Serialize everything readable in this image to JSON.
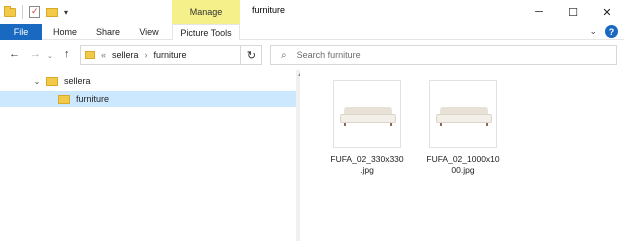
{
  "window": {
    "title": "furniture",
    "contextual_group": "Manage",
    "controls": {
      "minimize": "─",
      "maximize": "☐",
      "close": "✕"
    }
  },
  "quick_access": {
    "dropdown": "▾"
  },
  "ribbon": {
    "tabs": [
      "File",
      "Home",
      "Share",
      "View",
      "Picture Tools"
    ],
    "collapse": "⌄",
    "help": "?"
  },
  "address": {
    "back": "←",
    "forward": "→",
    "history": "⌄",
    "up": "↑",
    "overflow": "«",
    "crumbs": [
      "sellera",
      "furniture"
    ],
    "separator": "›",
    "dropdown": "⌄",
    "refresh": "↻"
  },
  "search": {
    "placeholder": "Search furniture",
    "icon": "⌕"
  },
  "tree": [
    {
      "caret": "⌄",
      "label": "sellera"
    },
    {
      "caret": "",
      "label": "furniture"
    }
  ],
  "files": [
    {
      "name": "FUFA_02_330x330.jpg",
      "name_line1": "FUFA_02_330x330",
      "name_line2": ".jpg"
    },
    {
      "name": "FUFA_02_1000x1000.jpg",
      "name_line1": "FUFA_02_1000x10",
      "name_line2": "00.jpg"
    }
  ],
  "colors": {
    "accent": "#1a69c1",
    "manage_tab": "#f6f08a",
    "selection": "#cce8ff",
    "folder": "#f3c94a"
  }
}
